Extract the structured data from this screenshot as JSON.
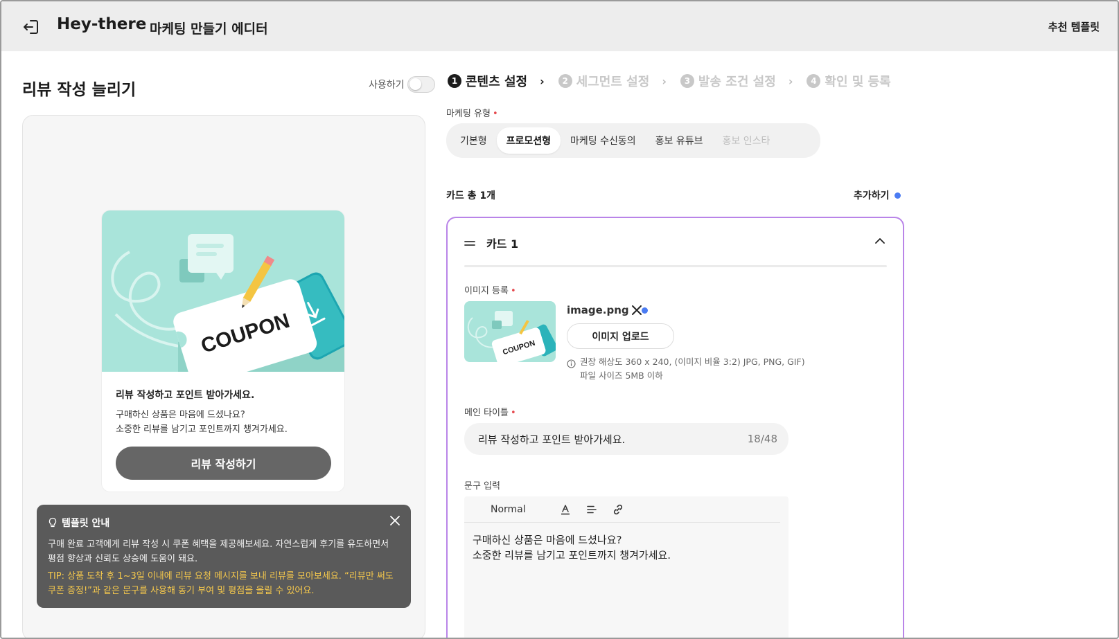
{
  "header": {
    "brand": "Hey-there",
    "editor_title": "마케팅 만들기 에디터",
    "recommend_label": "추천 템플릿"
  },
  "left": {
    "template_title": "리뷰 작성 늘리기",
    "use_label": "사용하기",
    "use_enabled": false,
    "preview": {
      "coupon_text": "COUPON",
      "title": "리뷰 작성하고 포인트 받아가세요.",
      "body_line1": "구매하신 상품은 마음에 드셨나요?",
      "body_line2": "소중한 리뷰를 남기고 포인트까지 챙겨가세요.",
      "button_label": "리뷰 작성하기"
    },
    "guide": {
      "title": "템플릿 안내",
      "text": "구매 완료 고객에게 리뷰 작성 시 쿠폰 혜택을 제공해보세요. 자연스럽게 후기를 유도하면서 평점 향상과 신뢰도 상승에 도움이 돼요.",
      "tip": "TIP: 상품 도착 후 1~3일 이내에 리뷰 요청 메시지를 보내 리뷰를 모아보세요. “리뷰만 써도 쿠폰 증정!”과 같은 문구를 사용해 동기 부여 및 평점을 올릴 수 있어요."
    }
  },
  "steps": [
    {
      "num": "1",
      "label": "콘텐츠 설정",
      "active": true
    },
    {
      "num": "2",
      "label": "세그먼트 설정",
      "active": false
    },
    {
      "num": "3",
      "label": "발송 조건 설정",
      "active": false
    },
    {
      "num": "4",
      "label": "확인 및 등록",
      "active": false
    }
  ],
  "marketing_type": {
    "label": "마케팅 유형",
    "tabs": [
      {
        "label": "기본형",
        "state": "normal"
      },
      {
        "label": "프로모션형",
        "state": "selected"
      },
      {
        "label": "마케팅 수신동의",
        "state": "normal"
      },
      {
        "label": "홍보 유튜브",
        "state": "normal"
      },
      {
        "label": "홍보 인스타",
        "state": "disabled"
      }
    ]
  },
  "cards": {
    "count_label": "카드 총 1개",
    "add_label": "추가하기",
    "card": {
      "name": "카드 1",
      "image_label": "이미지 등록",
      "filename": "image.png",
      "upload_label": "이미지 업로드",
      "hint_line1": "권장 해상도 360 x 240, (이미지 비율 3:2) JPG, PNG, GIF)",
      "hint_line2": "파일 사이즈 5MB 이하",
      "main_title_label": "메인 타이틀",
      "main_title_value": "리뷰 작성하고 포인트 받아가세요.",
      "main_title_counter": "18/48",
      "text_label": "문구 입력",
      "rte_format": "Normal",
      "rte_line1": "구매하신 상품은 마음에 드셨나요?",
      "rte_line2": "소중한 리뷰를 남기고 포인트까지 챙겨가세요."
    }
  },
  "colors": {
    "accent_purple": "#b984e8",
    "required_red": "#e5484d",
    "dot_blue": "#4b7cf3",
    "tip_yellow": "#f5c84c",
    "illustration_mint": "#a9e4da"
  }
}
